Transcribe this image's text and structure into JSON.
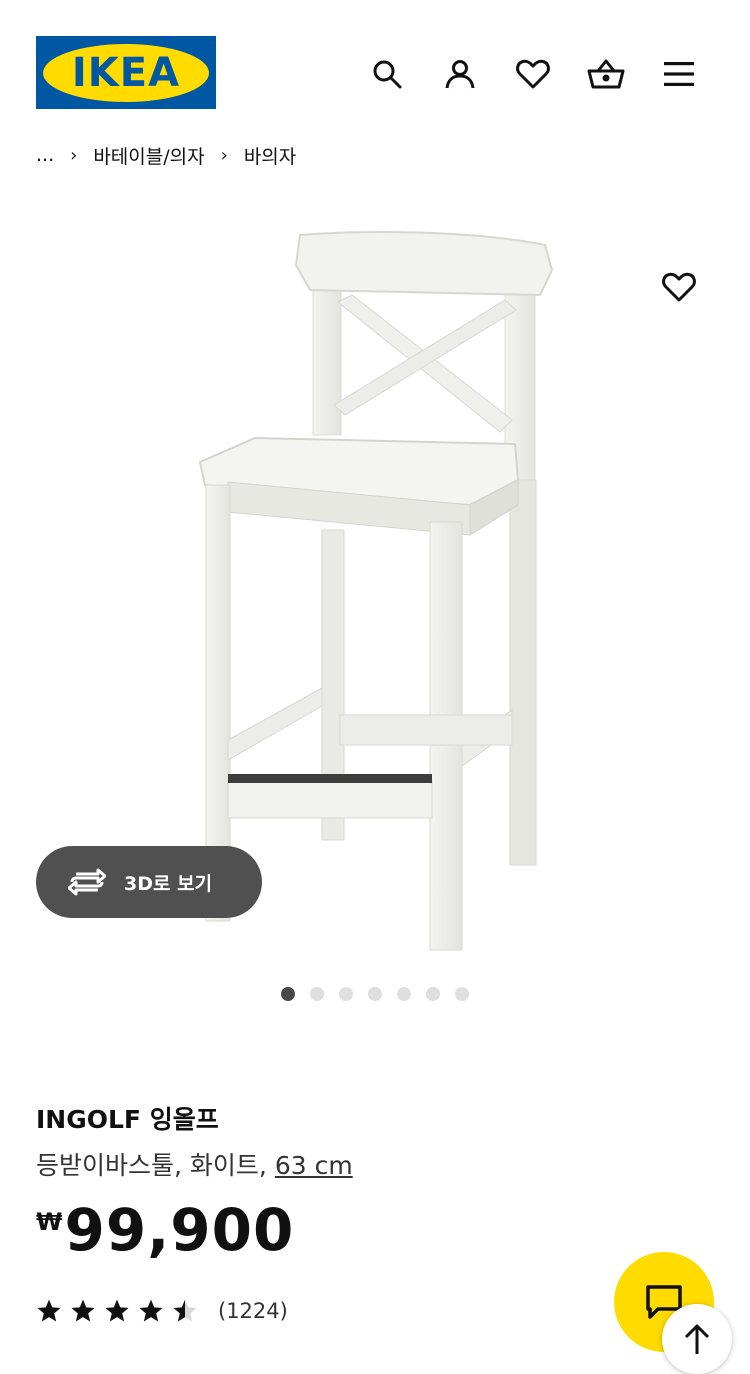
{
  "header": {
    "logo_text": "IKEA",
    "icons": [
      "search-icon",
      "account-icon",
      "heart-icon",
      "cart-icon",
      "menu-icon"
    ]
  },
  "breadcrumb": {
    "ellipsis": "...",
    "items": [
      "바테이블/의자",
      "바의자"
    ]
  },
  "gallery": {
    "view_3d_label": "3D로 보기",
    "active_index": 0,
    "total_images": 7
  },
  "product": {
    "name": "INGOLF 잉올프",
    "description": "등받이바스툴, 화이트,",
    "size": "63 cm",
    "currency": "₩",
    "price": "99,900",
    "rating": 4.5,
    "rating_max": 5,
    "review_count": "(1224)"
  },
  "colors": {
    "brand_blue": "#0058a3",
    "brand_yellow": "#ffdb00"
  }
}
